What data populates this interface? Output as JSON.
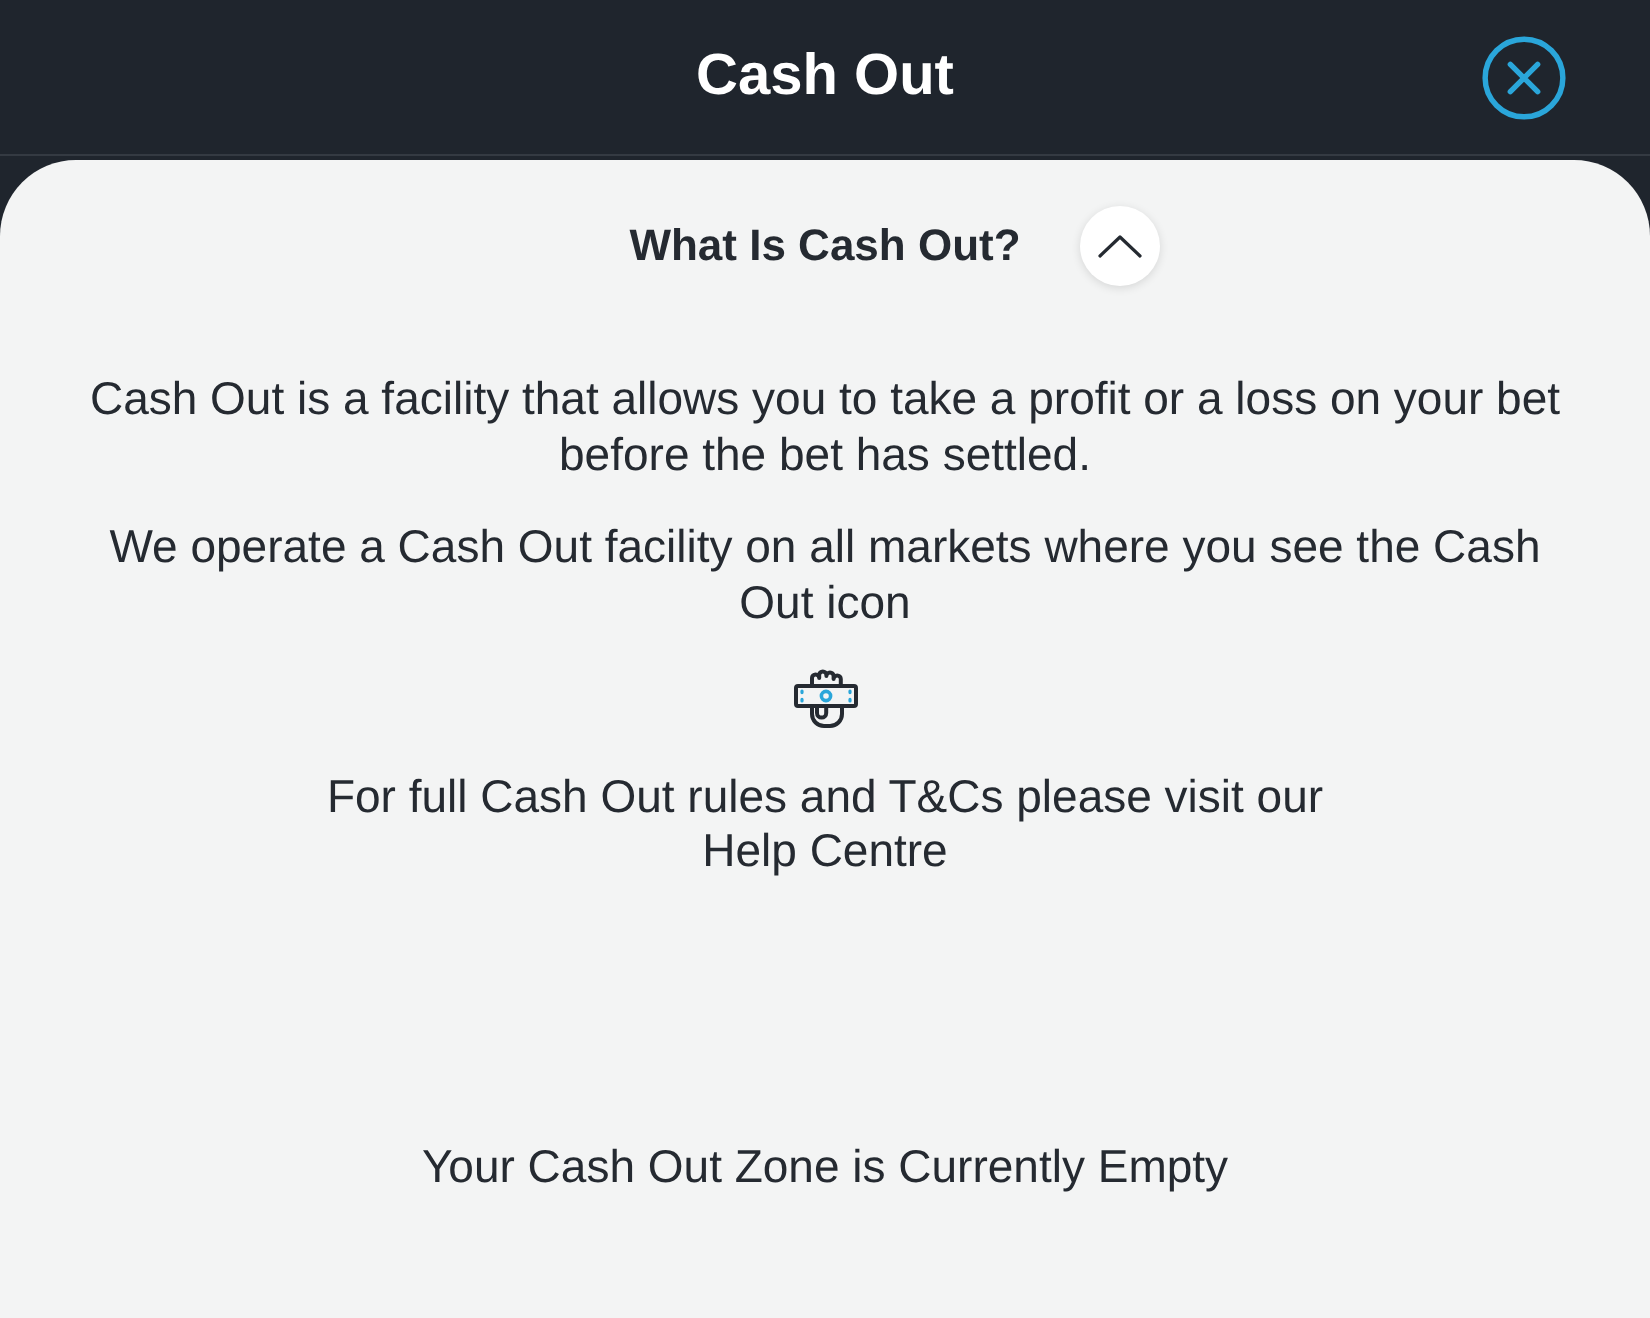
{
  "header": {
    "title": "Cash Out"
  },
  "info": {
    "heading": "What Is Cash Out?",
    "expanded": true,
    "paragraphs": [
      "Cash Out is a facility that allows you to take a profit or a loss on your bet before the bet has settled.",
      "We operate a Cash Out facility on all markets where you see the Cash Out icon"
    ],
    "help_text": "For full Cash Out rules and T&Cs please visit our",
    "help_link": "Help Centre"
  },
  "empty_message": "Your Cash Out Zone is Currently Empty"
}
